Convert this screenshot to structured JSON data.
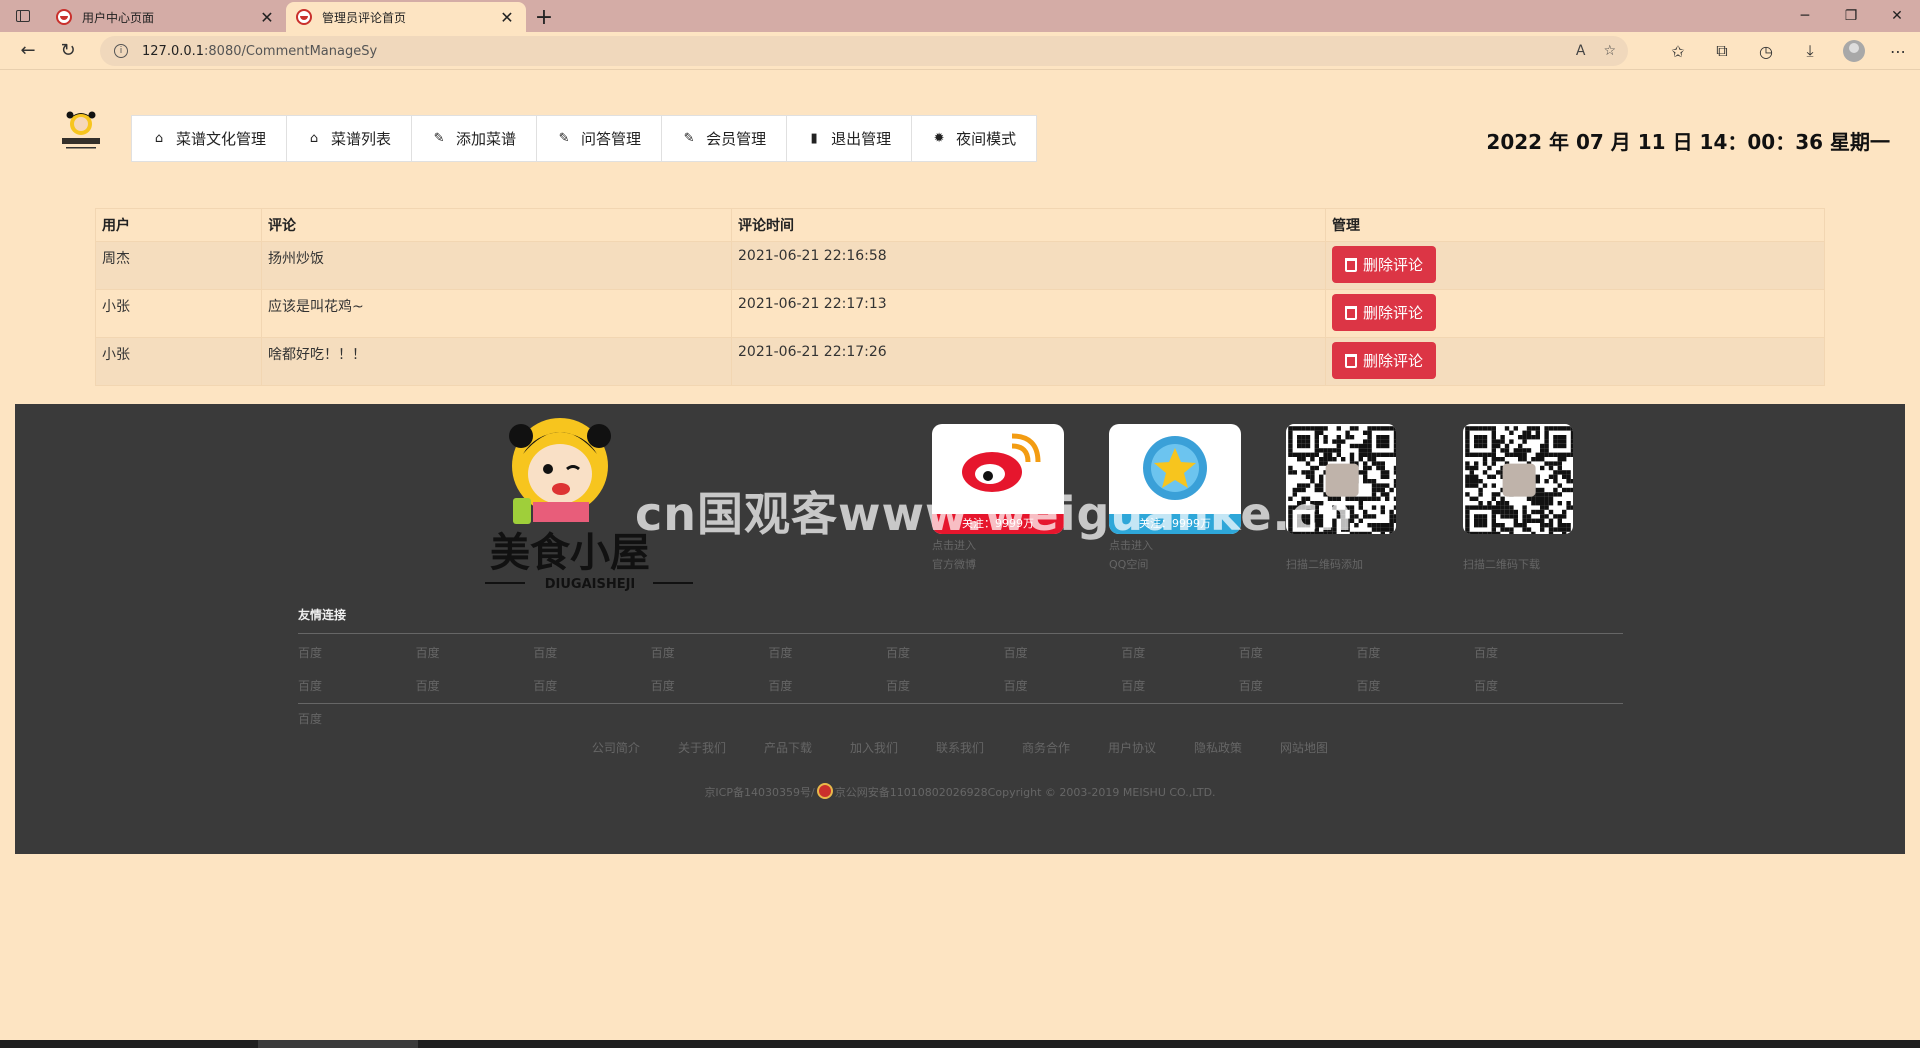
{
  "browser": {
    "tabs": [
      {
        "title": "用户中心页面",
        "active": false
      },
      {
        "title": "管理员评论首页",
        "active": true
      }
    ],
    "url_host": "127.0.0.1",
    "url_rest": ":8080/CommentManageSy"
  },
  "header": {
    "nav": [
      {
        "label": "菜谱文化管理",
        "icon": "home-icon",
        "glyph": "⌂"
      },
      {
        "label": "菜谱列表",
        "icon": "home-icon",
        "glyph": "⌂"
      },
      {
        "label": "添加菜谱",
        "icon": "pencil-icon",
        "glyph": "✎"
      },
      {
        "label": "问答管理",
        "icon": "pencil-icon",
        "glyph": "✎"
      },
      {
        "label": "会员管理",
        "icon": "pencil-icon",
        "glyph": "✎"
      },
      {
        "label": "退出管理",
        "icon": "book-icon",
        "glyph": "▮"
      },
      {
        "label": "夜间模式",
        "icon": "gear-icon",
        "glyph": "✹"
      }
    ],
    "datetime": "2022 年 07 月 11 日 14：00：36 星期一"
  },
  "table": {
    "headers": [
      "用户",
      "评论",
      "评论时间",
      "管理"
    ],
    "rows": [
      {
        "user": "周杰",
        "comment": "扬州炒饭",
        "time": "2021-06-21 22:16:58",
        "action": "删除评论"
      },
      {
        "user": "小张",
        "comment": "应该是叫花鸡~",
        "time": "2021-06-21 22:17:13",
        "action": "删除评论"
      },
      {
        "user": "小张",
        "comment": "啥都好吃！！！",
        "time": "2021-06-21 22:17:26",
        "action": "删除评论"
      }
    ]
  },
  "footer": {
    "logo_text": "美食小屋",
    "logo_sub": "DIUGAISHEJI",
    "weibo": {
      "follow": "关注：9999万",
      "line1": "点击进入",
      "line2": "官方微博",
      "color": "#e6162d"
    },
    "qq": {
      "follow": "关注：9999万",
      "line1": "点击进入",
      "line2": "QQ空间",
      "color": "#2ea7d9"
    },
    "qr1_caption": "扫描二维码添加",
    "qr2_caption": "扫描二维码下载",
    "links_title": "友情连接",
    "links": [
      "百度",
      "百度",
      "百度",
      "百度",
      "百度",
      "百度",
      "百度",
      "百度",
      "百度",
      "百度",
      "百度",
      "百度",
      "百度",
      "百度",
      "百度",
      "百度",
      "百度",
      "百度",
      "百度",
      "百度",
      "百度",
      "百度",
      "百度"
    ],
    "nav": [
      "公司简介",
      "关于我们",
      "产品下载",
      "加入我们",
      "联系我们",
      "商务合作",
      "用户协议",
      "隐私政策",
      "网站地图"
    ],
    "copyright_left": "京ICP备14030359号/",
    "copyright_right": "京公网安备11010802026928Copyright © 2003-2019 MEISHU CO.,LTD."
  },
  "watermark": "cn国观客www.weiguanke.cn"
}
